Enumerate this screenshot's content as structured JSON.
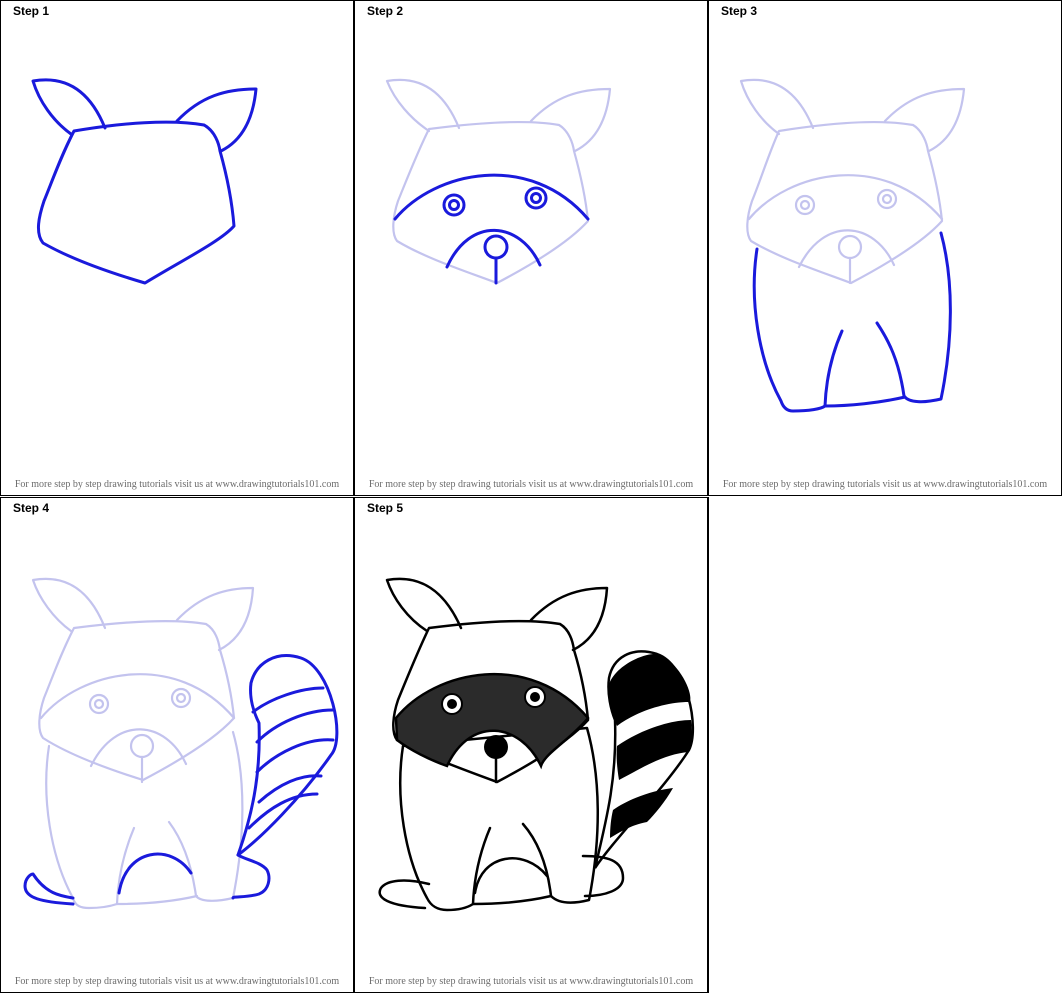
{
  "steps": [
    {
      "title": "Step 1",
      "footer": "For more step by step drawing tutorials visit us at www.drawingtutorials101.com"
    },
    {
      "title": "Step 2",
      "footer": "For more step by step drawing tutorials visit us at www.drawingtutorials101.com"
    },
    {
      "title": "Step 3",
      "footer": "For more step by step drawing tutorials visit us at www.drawingtutorials101.com"
    },
    {
      "title": "Step 4",
      "footer": "For more step by step drawing tutorials visit us at www.drawingtutorials101.com"
    },
    {
      "title": "Step 5",
      "footer": "For more step by step drawing tutorials visit us at www.drawingtutorials101.com"
    }
  ],
  "colors": {
    "new_stroke": "#1a1adc",
    "faded_stroke": "#c3c3ee",
    "final_stroke": "#000000",
    "mask_fill": "#2b2b2b"
  },
  "subject": "raccoon-drawing"
}
